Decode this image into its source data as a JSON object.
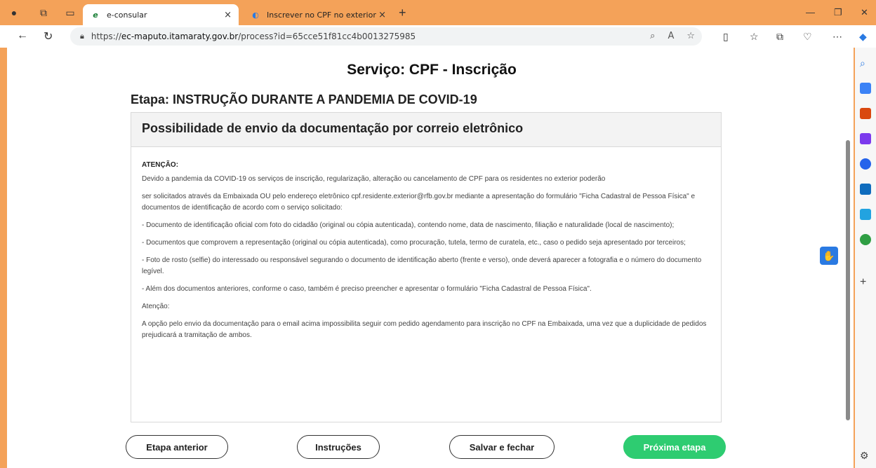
{
  "browser": {
    "tabs": [
      {
        "title": "e-consular",
        "close": "×"
      },
      {
        "title": "Inscrever no CPF no exterior",
        "close": "×"
      }
    ],
    "new_tab": "+",
    "url_prefix": "https://",
    "url_domain": "ec-maputo.itamaraty.gov.br",
    "url_path": "/process?id=65cce51f81cc4b0013275985"
  },
  "page": {
    "title": "Serviço: CPF - Inscrição",
    "stage": "Etapa: INSTRUÇÃO DURANTE A PANDEMIA DE COVID-19",
    "card_title": "Possibilidade de envio da documentação por correio eletrônico",
    "attention_label": "ATENÇÃO:",
    "paragraphs": [
      "Devido a pandemia da COVID-19 os serviços de inscrição, regularização, alteração ou cancelamento de CPF para os residentes no exterior poderão",
      "ser solicitados através da Embaixada OU pelo endereço eletrônico cpf.residente.exterior@rfb.gov.br mediante a apresentação do formulário \"Ficha Cadastral de Pessoa Física\" e documentos de identificação de acordo com o serviço solicitado:",
      "- Documento de identificação oficial com foto do cidadão (original ou cópia autenticada), contendo nome, data de nascimento, filiação e naturalidade (local de nascimento);",
      "- Documentos que comprovem a representação (original ou cópia autenticada), como procuração, tutela, termo de curatela, etc., caso o pedido seja apresentado por terceiros;",
      "- Foto de rosto (selfie) do interessado ou responsável segurando o documento de identificação aberto (frente e verso), onde deverá aparecer a fotografia e o número do documento legível.",
      "- Além dos documentos anteriores, conforme o caso, também é preciso preencher e apresentar o formulário \"Ficha Cadastral de Pessoa Física\".",
      "Atenção:",
      "A opção pelo envio da documentação para o email acima impossibilita seguir com pedido agendamento para inscrição no CPF na Embaixada, uma vez que a duplicidade de pedidos prejudicará a tramitação de ambos."
    ],
    "buttons": {
      "previous": "Etapa anterior",
      "instructions": "Instruções",
      "save_close": "Salvar e fechar",
      "next": "Próxima etapa"
    }
  },
  "colors": {
    "primary_button": "#2ecc71",
    "backdrop": "#f4a259"
  }
}
